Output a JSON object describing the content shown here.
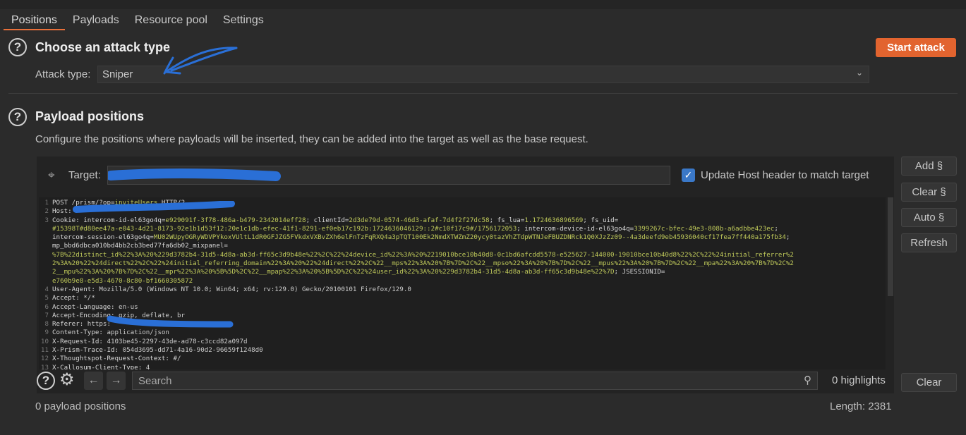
{
  "tabs": [
    "Positions",
    "Payloads",
    "Resource pool",
    "Settings"
  ],
  "attack": {
    "title": "Choose an attack type",
    "label": "Attack type:",
    "value": "Sniper",
    "start": "Start attack"
  },
  "positions": {
    "title": "Payload positions",
    "description": "Configure the positions where payloads will be inserted, they can be added into the target as well as the base request.",
    "target_label": "Target:",
    "update_host": "Update Host header to match target",
    "update_host_checked": true
  },
  "buttons": {
    "add": "Add §",
    "clear": "Clear §",
    "auto": "Auto §",
    "refresh": "Refresh",
    "clear_search": "Clear"
  },
  "search": {
    "placeholder": "Search",
    "highlights": "0 highlights"
  },
  "footer": {
    "count": "0 payload positions",
    "length": "Length: 2381"
  },
  "colors": {
    "accent": "#e2642f",
    "checkbox": "#3a78c8",
    "redaction": "#2a6fd6"
  },
  "request": [
    {
      "n": "1",
      "parts": [
        [
          "POST /prism/?op=",
          "k"
        ],
        [
          "inviteUsers",
          "v"
        ],
        [
          " HTTP/2",
          "k"
        ]
      ]
    },
    {
      "n": "2",
      "parts": [
        [
          "Host: ",
          "k"
        ]
      ]
    },
    {
      "n": "3",
      "parts": [
        [
          "Cookie: intercom-id-el63go4q=",
          "k"
        ],
        [
          "e929091f-3f78-486a-b479-2342014eff28",
          "v"
        ],
        [
          "; clientId=",
          "k"
        ],
        [
          "2d3de79d-0574-46d3-afaf-7d4f2f27dc58",
          "v"
        ],
        [
          "; fs_lua=",
          "k"
        ],
        [
          "1.1724636896569",
          "v"
        ],
        [
          "; fs_uid=",
          "k"
        ]
      ]
    },
    {
      "n": "",
      "parts": [
        [
          "#15398T#d80ee47a-e043-4d21-8173-92e1b1d53f12:20e1c1db-efec-41f1-8291-ef0eb17c192b:1724636046129::2#c10f17c9#/1756172053",
          "v"
        ],
        [
          "; intercom-device-id-el63go4q=",
          "k"
        ],
        [
          "3399267c-bfec-49e3-808b-a6adbbe423ec",
          "v"
        ],
        [
          ";",
          "k"
        ]
      ]
    },
    {
      "n": "",
      "parts": [
        [
          "intercom-session-el63go4q=",
          "k"
        ],
        [
          "MU02WUpyOGRyWDVPYkoxVUltL1dR0GFJZG5FVkdxVXBvZXh6elFnTzFqRXQ4a3pTQT100Ek2NmdXTWZmZ20ycy0tazVhZTdpWTNJeFBUZDNRck1Q0XJzZz09--4a3deefd9eb45936040cf17fea7ff440a175fb34",
          "v"
        ],
        [
          ";",
          "k"
        ]
      ]
    },
    {
      "n": "",
      "parts": [
        [
          "mp_bbd6dbca010bd4bb2cb3bed77fa6db02_mixpanel=",
          "k"
        ]
      ]
    },
    {
      "n": "",
      "parts": [
        [
          "%7B%22distinct_id%22%3A%20%229d3782b4-31d5-4d8a-ab3d-ff65c3d9b48e%22%2C%22%24device_id%22%3A%20%2219010bce10b40d8-0c1bd6afcdd5578-e525627-144000-19010bce10b40d8%22%2C%22%24initial_referrer%2",
          "v"
        ]
      ]
    },
    {
      "n": "",
      "parts": [
        [
          "2%3A%20%22%24direct%22%2C%22%24initial_referring_domain%22%3A%20%22%24direct%22%2C%22__mps%22%3A%20%7B%7D%2C%22__mpso%22%3A%20%7B%7D%2C%22__mpus%22%3A%20%7B%7D%2C%22__mpa%22%3A%20%7B%7D%2C%2",
          "v"
        ]
      ]
    },
    {
      "n": "",
      "parts": [
        [
          "2__mpu%22%3A%20%7B%7D%2C%22__mpr%22%3A%20%5B%5D%2C%22__mpap%22%3A%20%5B%5D%2C%22%24user_id%22%3A%20%229d3782b4-31d5-4d8a-ab3d-ff65c3d9b48e%22%7D",
          "v"
        ],
        [
          "; JSESSIONID=",
          "k"
        ]
      ]
    },
    {
      "n": "",
      "parts": [
        [
          "e760b9e8-e5d3-4670-8c80-bf1660305872",
          "v"
        ]
      ]
    },
    {
      "n": "4",
      "parts": [
        [
          "User-Agent: ",
          "k"
        ],
        [
          "Mozilla/5.0 (Windows NT 10.0; Win64; x64; rv:129.0) Gecko/20100101 Firefox/129.0",
          "p"
        ]
      ]
    },
    {
      "n": "5",
      "parts": [
        [
          "Accept: ",
          "k"
        ],
        [
          "*/*",
          "p"
        ]
      ]
    },
    {
      "n": "6",
      "parts": [
        [
          "Accept-Language: ",
          "k"
        ],
        [
          "en-us",
          "p"
        ]
      ]
    },
    {
      "n": "7",
      "parts": [
        [
          "Accept-Encoding: ",
          "k"
        ],
        [
          "gzip, deflate, br",
          "p"
        ]
      ]
    },
    {
      "n": "8",
      "parts": [
        [
          "Referer: ",
          "k"
        ],
        [
          "https:",
          "p"
        ]
      ]
    },
    {
      "n": "9",
      "parts": [
        [
          "Content-Type: ",
          "k"
        ],
        [
          "application/json",
          "p"
        ]
      ]
    },
    {
      "n": "10",
      "parts": [
        [
          "X-Request-Id: ",
          "k"
        ],
        [
          "4103be45-2297-43de-ad78-c3ccd82a097d",
          "p"
        ]
      ]
    },
    {
      "n": "11",
      "parts": [
        [
          "X-Prism-Trace-Id: ",
          "k"
        ],
        [
          "054d3695-dd71-4a16-90d2-96659f1248d0",
          "p"
        ]
      ]
    },
    {
      "n": "12",
      "parts": [
        [
          "X-Thoughtspot-Request-Context: ",
          "k"
        ],
        [
          "#/",
          "p"
        ]
      ]
    },
    {
      "n": "13",
      "parts": [
        [
          "X-Callosum-Client-Type: ",
          "k"
        ],
        [
          "4",
          "p"
        ]
      ]
    }
  ]
}
